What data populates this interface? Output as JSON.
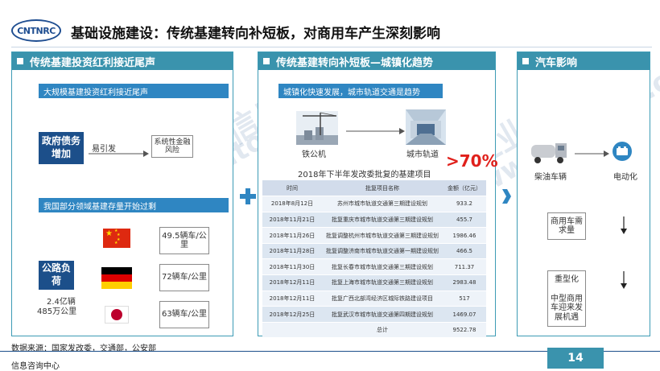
{
  "header": {
    "logo_text": "CNTNRC",
    "title": "基础设施建设：传统基建转向补短板，对商用车产生深刻影响"
  },
  "left_panel": {
    "title": "传统基建投资红利接近尾声",
    "bar1": "大规模基建投资红利接近尾声",
    "gov_debt": "政府债务增加",
    "trigger": "易引发",
    "risk": "系统性金融风险",
    "bar2": "我国部分领域基建存量开始过剩",
    "road_load": "公路负荷",
    "road_stats_line1": "2.4亿辆",
    "road_stats_line2": "485万公里",
    "countries": [
      {
        "flag": "china-flag",
        "value": "49.5辆车/公里"
      },
      {
        "flag": "germany-flag",
        "value": "72辆车/公里"
      },
      {
        "flag": "japan-flag",
        "value": "63辆车/公里"
      }
    ]
  },
  "middle_panel": {
    "title": "传统基建转向补短板—城镇化趋势",
    "bar": "城镇化快速发展，城市轨道交通是趋势",
    "from_label": "铁公机",
    "to_label": "城市轨道",
    "big_percent": ">70%",
    "table_title": "2018年下半年发改委批复的基建项目",
    "table_headers": [
      "时间",
      "批复项目名称",
      "金额（亿元）"
    ],
    "table_rows": [
      [
        "2018年8月12日",
        "苏州市城市轨道交通第三期建设规划",
        "933.2"
      ],
      [
        "2018年11月21日",
        "批复重庆市城市轨道交通第三期建设规划",
        "455.7"
      ],
      [
        "2018年11月26日",
        "批复调整杭州市城市轨道交通第三期建设规划",
        "1986.46"
      ],
      [
        "2018年11月28日",
        "批复调整济南市城市轨道交通第一期建设规划",
        "466.5"
      ],
      [
        "2018年11月30日",
        "批复长春市城市轨道交通第三期建设规划",
        "711.37"
      ],
      [
        "2018年12月11日",
        "批复上海市城市轨道交通第三期建设规划",
        "2983.48"
      ],
      [
        "2018年12月11日",
        "批复广西北部湾经济区城际铁路建设项目",
        "517"
      ],
      [
        "2018年12月25日",
        "批复武汉市城市轨道交通第四期建设规划",
        "1469.07"
      ]
    ],
    "table_total_label": "总计",
    "table_total_value": "9522.78"
  },
  "right_panel": {
    "title": "汽车影响",
    "diesel": "柴油车辆",
    "electric": "电动化",
    "demand": "商用车需求量",
    "heavy": "重型化",
    "mid_heavy": "中型商用车迎来发展机遇"
  },
  "footer": {
    "source": "数据来源：国家发改委，交通部，公安部",
    "org": "信息咨询中心",
    "page": "14"
  },
  "watermarks": [
    "中国汽车工业信息网",
    "www.autoinfo.org.cn",
    "中国汽车工业信息网",
    "www.autoinfo.org.cn"
  ],
  "colors": {
    "accent": "#3a93ad",
    "navy": "#1c4f8a",
    "bar_blue": "#2f86c2",
    "red": "#e0201b"
  }
}
